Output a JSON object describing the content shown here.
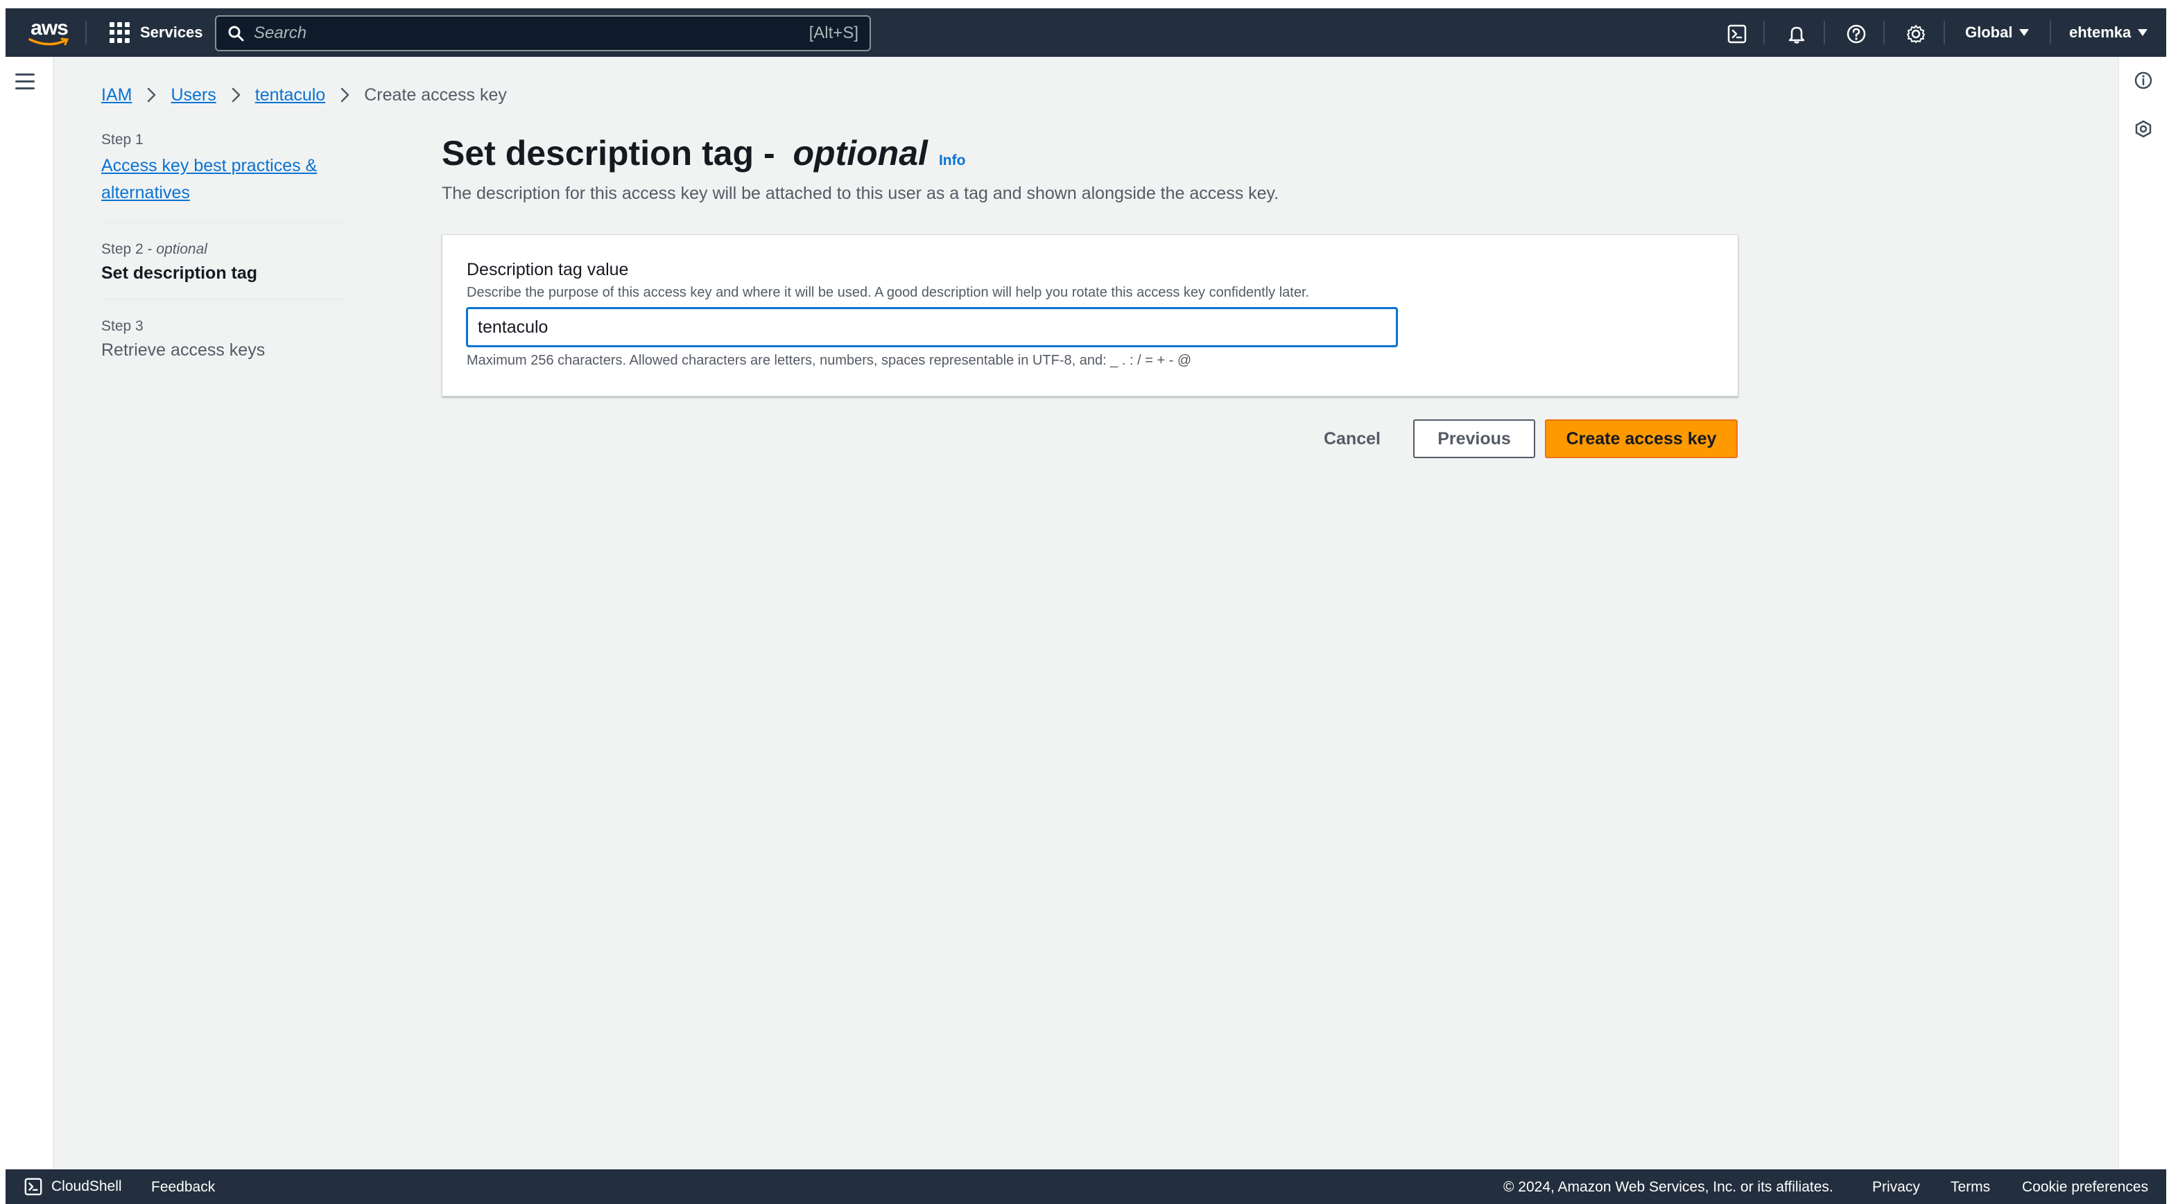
{
  "topnav": {
    "logo_text": "aws",
    "services_label": "Services",
    "search_placeholder": "Search",
    "search_shortcut": "[Alt+S]",
    "region_label": "Global",
    "account_label": "ehtemka",
    "icons": [
      "cloudshell-icon",
      "bell-icon",
      "help-icon",
      "gear-icon"
    ]
  },
  "breadcrumb": {
    "items": [
      {
        "label": "IAM",
        "link": true
      },
      {
        "label": "Users",
        "link": true
      },
      {
        "label": "tentaculo",
        "link": true
      },
      {
        "label": "Create access key",
        "link": false
      }
    ]
  },
  "steps": [
    {
      "number_label": "Step 1",
      "optional": "",
      "title": "Access key best practices & alternatives",
      "state": "link"
    },
    {
      "number_label": "Step 2 - ",
      "optional": "optional",
      "title": "Set description tag",
      "state": "current"
    },
    {
      "number_label": "Step 3",
      "optional": "",
      "title": "Retrieve access keys",
      "state": "disabled"
    }
  ],
  "main": {
    "title_prefix": "Set description tag - ",
    "title_optional": "optional",
    "info_label": "Info",
    "description": "The description for this access key will be attached to this user as a tag and shown alongside the access key."
  },
  "form": {
    "field_label": "Description tag value",
    "field_description": "Describe the purpose of this access key and where it will be used. A good description will help you rotate this access key confidently later.",
    "field_value": "tentaculo",
    "field_constraint": "Maximum 256 characters. Allowed characters are letters, numbers, spaces representable in UTF-8, and: _ . : / = + - @"
  },
  "actions": {
    "cancel_label": "Cancel",
    "previous_label": "Previous",
    "create_label": "Create access key"
  },
  "footer": {
    "cloudshell_label": "CloudShell",
    "feedback_label": "Feedback",
    "copyright": "© 2024, Amazon Web Services, Inc. or its affiliates.",
    "privacy_label": "Privacy",
    "terms_label": "Terms",
    "cookie_label": "Cookie preferences"
  },
  "colors": {
    "nav_bg": "#232f3e",
    "link": "#0972d3",
    "primary_button": "#ff9900",
    "page_bg": "#f1f3f3"
  }
}
